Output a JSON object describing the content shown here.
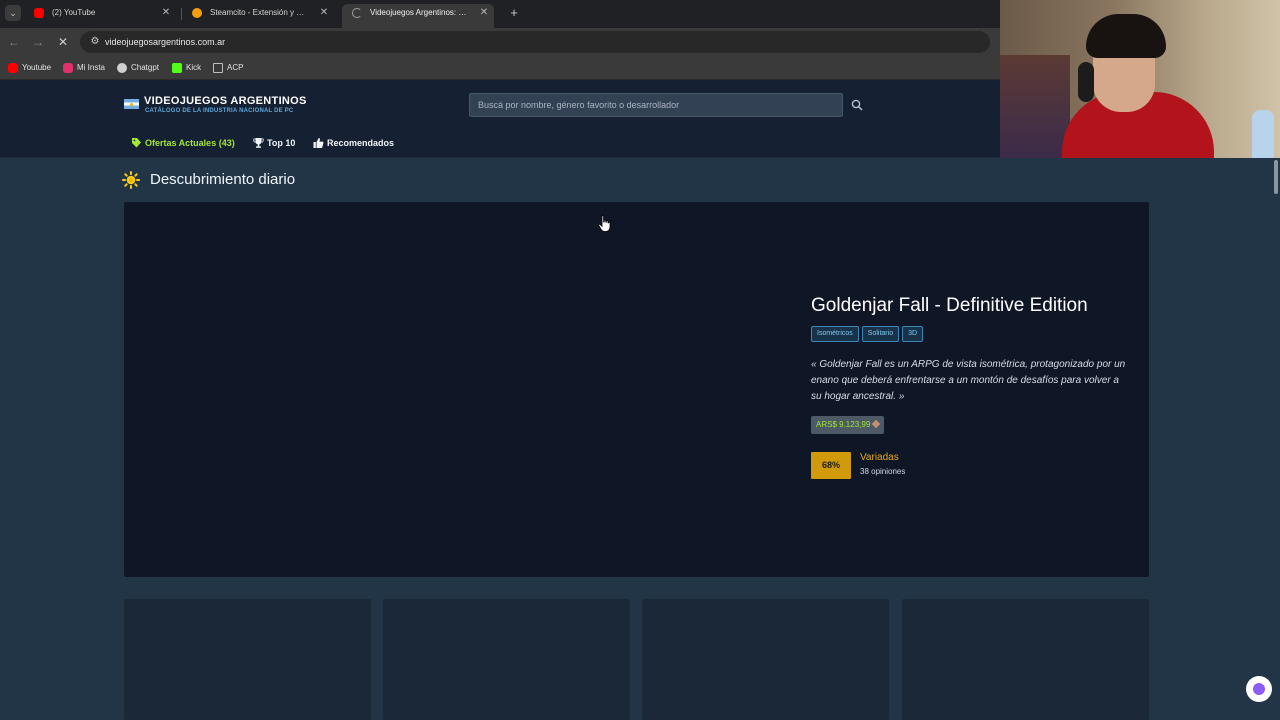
{
  "browser": {
    "tabs": [
      {
        "label": "(2) YouTube",
        "favicon": "youtube-icon",
        "favicon_color": "#ff0000"
      },
      {
        "label": "Steamcito - Extensión y Calcula",
        "favicon": "steamcito-icon",
        "favicon_color": "#f59e0b"
      },
      {
        "label": "Videojuegos Argentinos: Descu",
        "favicon": "loading-icon",
        "favicon_color": "#9aa0a6",
        "active": true
      }
    ],
    "url": "videojuegosargentinos.com.ar",
    "bookmarks": [
      {
        "label": "Youtube",
        "icon": "youtube-icon",
        "color": "#ff0000"
      },
      {
        "label": "Mi Insta",
        "icon": "instagram-icon",
        "color": "#e1306c"
      },
      {
        "label": "Chatgpt",
        "icon": "chatgpt-icon",
        "color": "#d0d0d0"
      },
      {
        "label": "Kick",
        "icon": "kick-icon",
        "color": "#53fc18"
      },
      {
        "label": "ACP",
        "icon": "folder-icon",
        "color": "#bdbdbd"
      }
    ]
  },
  "site": {
    "logo_title": "VIDEOJUEGOS ARGENTINOS",
    "logo_subtitle": "CATÁLOGO DE LA INDUSTRIA NACIONAL DE PC",
    "search_placeholder": "Buscá por nombre, género favorito o desarrollador",
    "nav": {
      "deals": "Ofertas Actuales (43)",
      "top": "Top 10",
      "recommended": "Recomendados"
    },
    "accent_color": "#a3e635"
  },
  "discovery": {
    "title": "Descubrimiento diario",
    "game": {
      "title": "Goldenjar Fall - Definitive Edition",
      "tags": [
        "Isométricos",
        "Solitario",
        "3D"
      ],
      "description": "« Goldenjar Fall es un ARPG de vista isométrica, protagonizado por un enano que deberá enfrentarse a un montón de desafíos para volver a su hogar ancestral. »",
      "price": "ARS$ 9.123,99",
      "score": "68%",
      "score_color": "#d19a0b",
      "verdict": "Variadas",
      "reviews": "38 opiniones"
    }
  }
}
